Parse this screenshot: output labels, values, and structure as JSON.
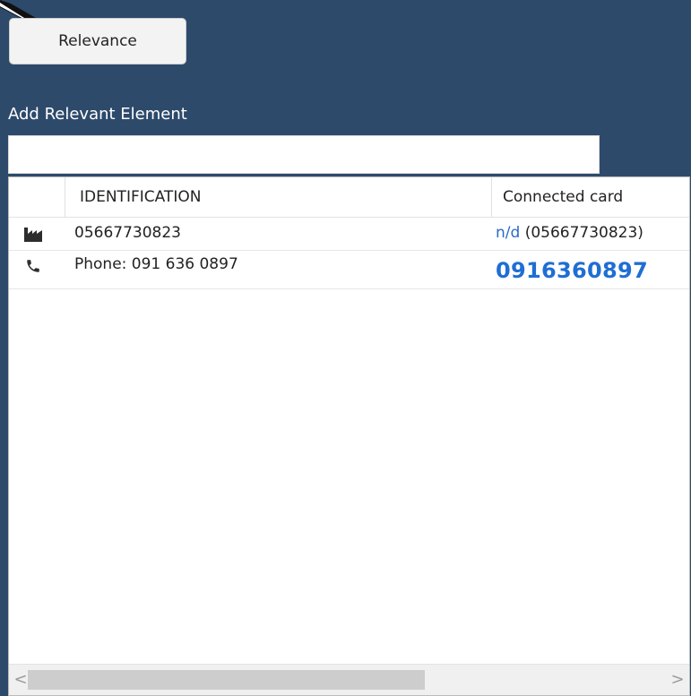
{
  "toolbar": {
    "relevance_label": "Relevance"
  },
  "add_relevant": {
    "label": "Add Relevant Element",
    "value": ""
  },
  "grid": {
    "columns": [
      {
        "label": ""
      },
      {
        "label": "IDENTIFICATION"
      },
      {
        "label": "Connected card"
      }
    ],
    "rows": [
      {
        "icon": "factory-icon",
        "identification": "05667730823",
        "card_link": "n/d",
        "card_extra": "(05667730823)"
      },
      {
        "icon": "phone-icon",
        "identification": "Phone: 091 636 0897",
        "card_link": "0916360897",
        "card_extra": ""
      }
    ]
  },
  "scrollbar": {
    "left_arrow": "<",
    "right_arrow": ">"
  },
  "colors": {
    "background": "#2d4a6b",
    "link": "#2b6cc4",
    "phone_link": "#1f6ed4"
  }
}
